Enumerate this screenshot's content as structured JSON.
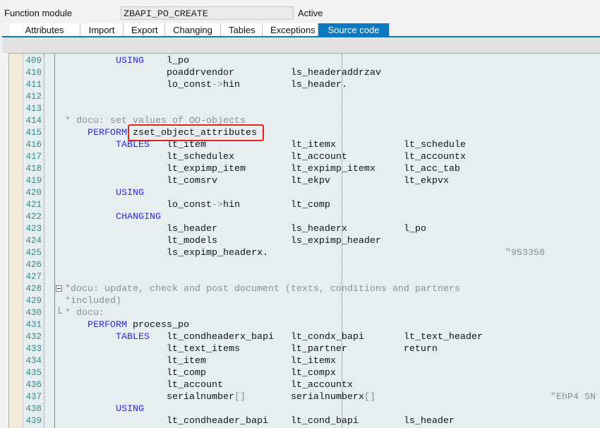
{
  "header": {
    "label": "Function module",
    "name": "ZBAPI_PO_CREATE",
    "status": "Active"
  },
  "tabs": [
    {
      "label": "Attributes",
      "active": false
    },
    {
      "label": "Import",
      "active": false
    },
    {
      "label": "Export",
      "active": false
    },
    {
      "label": "Changing",
      "active": false
    },
    {
      "label": "Tables",
      "active": false
    },
    {
      "label": "Exceptions",
      "active": false
    },
    {
      "label": "Source code",
      "active": true
    }
  ],
  "colors": {
    "accent": "#0a79bf",
    "keyword": "#2a2aee",
    "comment": "#8e8e8e",
    "line_number": "#2f8d8d",
    "highlight_box": "#e8211d"
  },
  "highlighted_text": "zset_object_attributes",
  "source": [
    {
      "n": "409",
      "s": [
        [
          "         ",
          ""
        ],
        [
          "USING",
          "kw"
        ],
        [
          "    l_po",
          ""
        ]
      ]
    },
    {
      "n": "410",
      "s": [
        [
          "                  poaddrvendor          ls_headeraddrzav",
          ""
        ]
      ]
    },
    {
      "n": "411",
      "s": [
        [
          "                  lo_const",
          ""
        ],
        [
          "->",
          "op"
        ],
        [
          "hin         ls_header.",
          ""
        ]
      ]
    },
    {
      "n": "412",
      "s": []
    },
    {
      "n": "413",
      "s": []
    },
    {
      "n": "414",
      "s": [
        [
          "* docu: set values of OO-objects",
          "cm"
        ]
      ]
    },
    {
      "n": "415",
      "s": [
        [
          "    ",
          ""
        ],
        [
          "PERFORM",
          "kw"
        ],
        [
          " zset_object_attributes",
          ""
        ]
      ]
    },
    {
      "n": "416",
      "s": [
        [
          "         ",
          ""
        ],
        [
          "TABLES",
          "kw"
        ],
        [
          "   lt_item               lt_itemx            lt_schedule",
          ""
        ]
      ]
    },
    {
      "n": "417",
      "s": [
        [
          "                  lt_schedulex          lt_account          lt_accountx",
          ""
        ]
      ]
    },
    {
      "n": "418",
      "s": [
        [
          "                  lt_expimp_item        lt_expimp_itemx     lt_acc_tab",
          ""
        ]
      ]
    },
    {
      "n": "419",
      "s": [
        [
          "                  lt_comsrv             lt_ekpv             lt_ekpvx",
          ""
        ]
      ]
    },
    {
      "n": "420",
      "s": [
        [
          "         ",
          ""
        ],
        [
          "USING",
          "kw"
        ]
      ]
    },
    {
      "n": "421",
      "s": [
        [
          "                  lo_const",
          ""
        ],
        [
          "->",
          "op"
        ],
        [
          "hin         lt_comp",
          ""
        ]
      ]
    },
    {
      "n": "422",
      "s": [
        [
          "         ",
          ""
        ],
        [
          "CHANGING",
          "kw"
        ]
      ]
    },
    {
      "n": "423",
      "s": [
        [
          "                  ls_header             ls_headerx          l_po",
          ""
        ]
      ]
    },
    {
      "n": "424",
      "s": [
        [
          "                  lt_models             ls_expimp_header",
          ""
        ]
      ]
    },
    {
      "n": "425",
      "s": [
        [
          "                  ls_expimp_headerx.                                          ",
          ""
        ],
        [
          "\"953358",
          "cm"
        ]
      ]
    },
    {
      "n": "426",
      "s": []
    },
    {
      "n": "427",
      "s": []
    },
    {
      "n": "428",
      "fold": "open",
      "s": [
        [
          "*docu: update, check and post document (texts, conditions and partners",
          "cm"
        ]
      ]
    },
    {
      "n": "429",
      "s": [
        [
          "*included)",
          "cm"
        ]
      ]
    },
    {
      "n": "430",
      "fold": "end",
      "s": [
        [
          "* docu:",
          "cm"
        ]
      ]
    },
    {
      "n": "431",
      "s": [
        [
          "    ",
          ""
        ],
        [
          "PERFORM",
          "kw"
        ],
        [
          " process_po",
          ""
        ]
      ]
    },
    {
      "n": "432",
      "s": [
        [
          "         ",
          ""
        ],
        [
          "TABLES",
          "kw"
        ],
        [
          "   lt_condheaderx_bapi   lt_condx_bapi       lt_text_header",
          ""
        ]
      ]
    },
    {
      "n": "433",
      "s": [
        [
          "                  lt_text_items         lt_partner          return",
          ""
        ]
      ]
    },
    {
      "n": "434",
      "s": [
        [
          "                  lt_item               lt_itemx",
          ""
        ]
      ]
    },
    {
      "n": "435",
      "s": [
        [
          "                  lt_comp               lt_compx",
          ""
        ]
      ]
    },
    {
      "n": "436",
      "s": [
        [
          "                  lt_account            lt_accountx",
          ""
        ]
      ]
    },
    {
      "n": "437",
      "s": [
        [
          "                  serialnumber",
          ""
        ],
        [
          "[]",
          "op"
        ],
        [
          "        serialnumberx",
          ""
        ],
        [
          "[]",
          "op"
        ],
        [
          "                               ",
          ""
        ],
        [
          "\"EhP4 SN",
          "cm"
        ]
      ]
    },
    {
      "n": "438",
      "s": [
        [
          "         ",
          ""
        ],
        [
          "USING",
          "kw"
        ]
      ]
    },
    {
      "n": "439",
      "s": [
        [
          "                  lt_condheader_bapi    lt_cond_bapi        ls_header",
          ""
        ]
      ]
    }
  ]
}
